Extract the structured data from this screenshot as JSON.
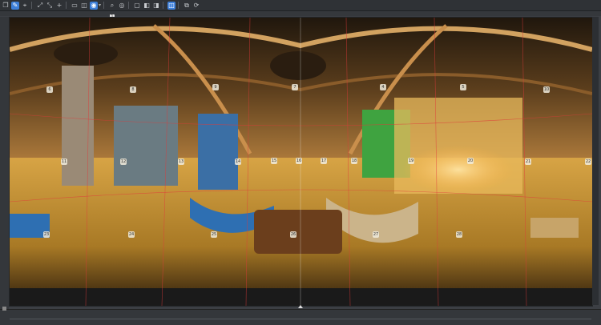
{
  "toolbar": {
    "tools": [
      {
        "name": "view-mode",
        "glyph": "❐",
        "active": false
      },
      {
        "name": "paint",
        "glyph": "✎",
        "active": true
      },
      {
        "name": "transform",
        "glyph": "⌖",
        "active": false
      },
      {
        "name": "expand",
        "glyph": "⤢",
        "active": false
      },
      {
        "name": "collapse",
        "glyph": "⤡",
        "active": false
      },
      {
        "name": "add",
        "glyph": "+",
        "active": false
      },
      {
        "name": "rect",
        "glyph": "▭",
        "active": false
      },
      {
        "name": "cylinder",
        "glyph": "◫",
        "active": false
      },
      {
        "name": "sphere",
        "glyph": "◉",
        "active": true
      },
      {
        "name": "zoom",
        "glyph": "⌕",
        "active": false
      },
      {
        "name": "eye",
        "glyph": "◎",
        "active": false
      },
      {
        "name": "frame-a",
        "glyph": "▢",
        "active": false
      },
      {
        "name": "frame-b",
        "glyph": "◧",
        "active": false
      },
      {
        "name": "frame-c",
        "glyph": "◨",
        "active": false
      },
      {
        "name": "split-view",
        "glyph": "◫",
        "active": true
      },
      {
        "name": "copy",
        "glyph": "⧉",
        "active": false
      },
      {
        "name": "refresh",
        "glyph": "⟳",
        "active": false
      }
    ]
  },
  "panorama": {
    "labels": [
      "6",
      "8",
      "9",
      "7",
      "4",
      "5",
      "10",
      "11",
      "12",
      "13",
      "14",
      "15",
      "16",
      "17",
      "18",
      "19",
      "20",
      "21",
      "22",
      "23",
      "24",
      "25",
      "26",
      "27",
      "28"
    ],
    "colors": {
      "ceiling": "#3a2a18",
      "warm": "#d89a3a",
      "floor": "#b8862e",
      "sofa_blue": "#2e6fb2",
      "green_wall": "#3fa340",
      "seam": "#e03a3a"
    }
  },
  "ruler": {
    "marker": "1"
  }
}
